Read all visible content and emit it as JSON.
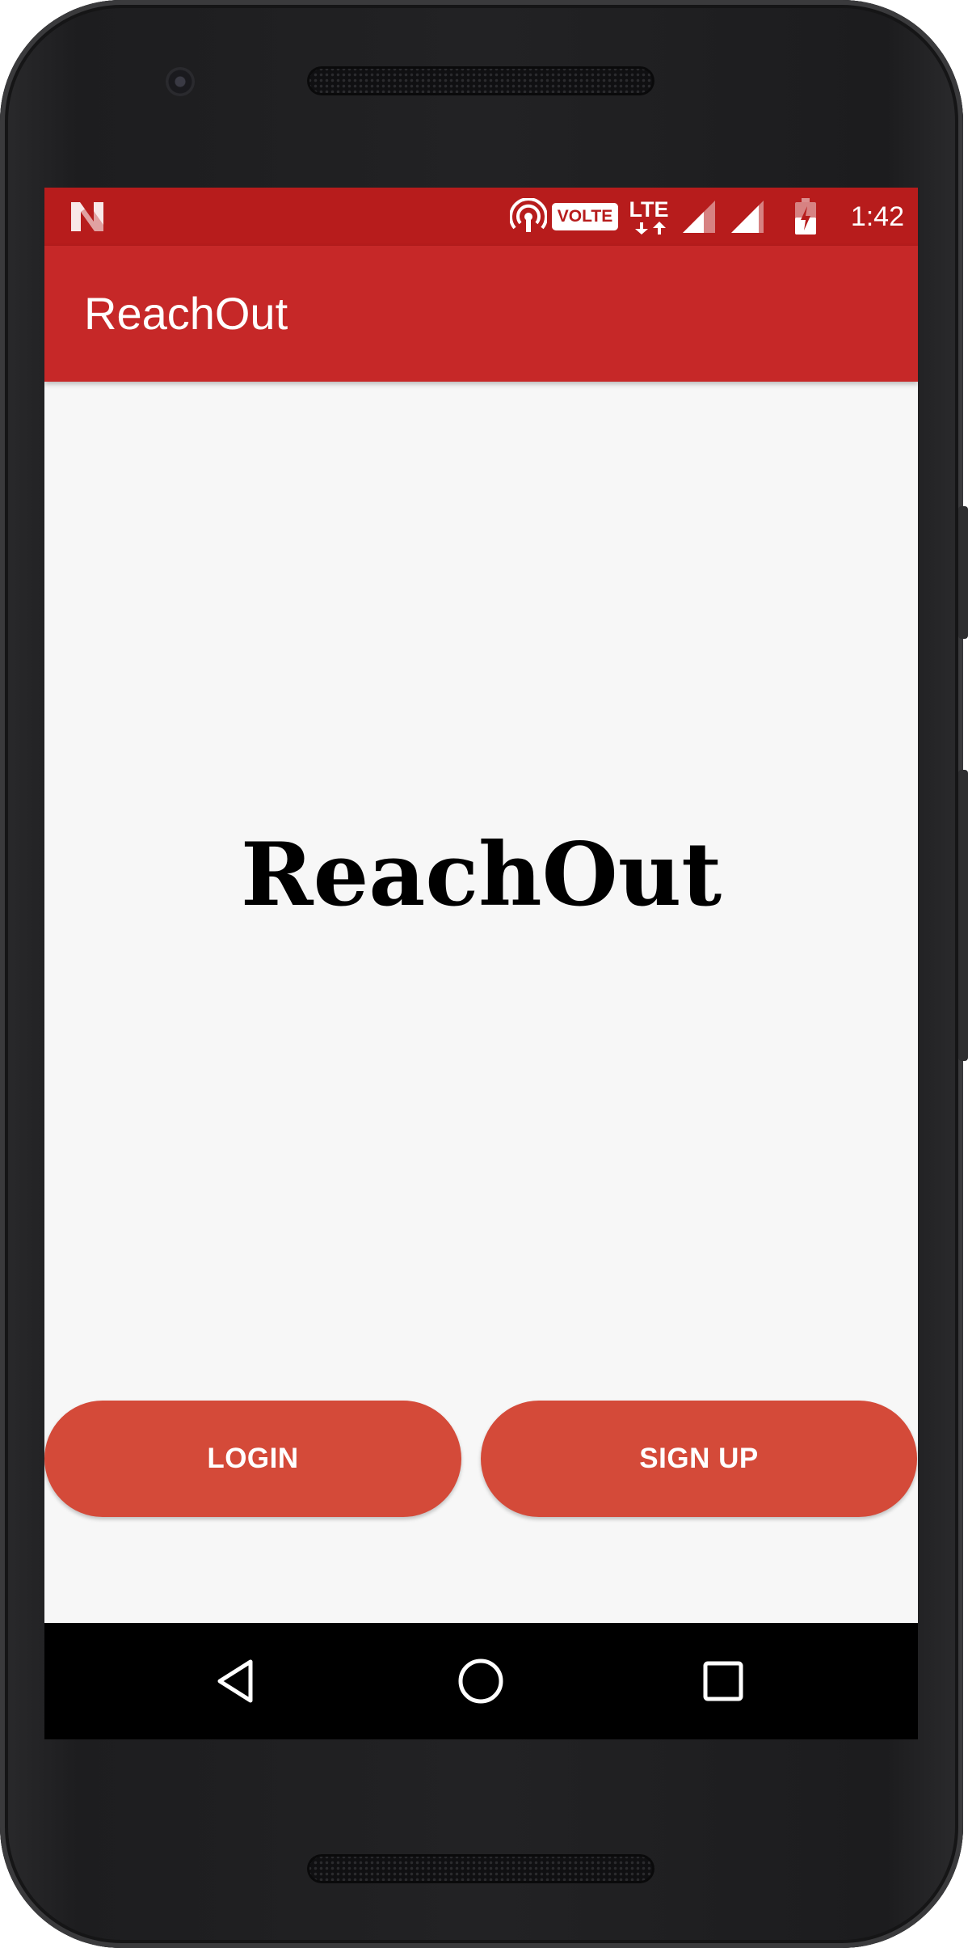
{
  "status_bar": {
    "time": "1:42",
    "volte_label": "VOLTE",
    "network_label": "LTE",
    "icons": [
      "notification-n-icon",
      "hotspot-icon",
      "volte-icon",
      "lte-data-icon",
      "signal-icon",
      "signal-icon",
      "battery-charging-icon"
    ]
  },
  "app_bar": {
    "title": "ReachOut"
  },
  "main": {
    "heading": "ReachOut",
    "login_label": "LOGIN",
    "signup_label": "SIGN UP"
  },
  "nav": {
    "icons": [
      "back-icon",
      "home-icon",
      "recents-icon"
    ]
  },
  "colors": {
    "status_bar": "#b71c1c",
    "app_bar": "#c62828",
    "button": "#d44a39",
    "background": "#f7f7f7"
  }
}
